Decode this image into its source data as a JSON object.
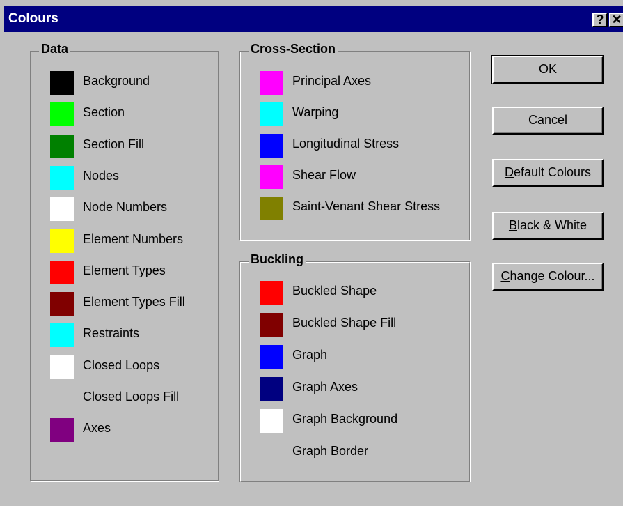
{
  "window": {
    "title": "Colours"
  },
  "titlebar_buttons": {
    "help": "?",
    "close": "✕"
  },
  "data_group": {
    "legend": "Data",
    "items": [
      {
        "label": "Background",
        "color": "#000000"
      },
      {
        "label": "Section",
        "color": "#00ff00"
      },
      {
        "label": "Section Fill",
        "color": "#008000"
      },
      {
        "label": "Nodes",
        "color": "#00ffff"
      },
      {
        "label": "Node Numbers",
        "color": "#ffffff"
      },
      {
        "label": "Element Numbers",
        "color": "#ffff00"
      },
      {
        "label": "Element Types",
        "color": "#ff0000"
      },
      {
        "label": "Element Types Fill",
        "color": "#800000"
      },
      {
        "label": "Restraints",
        "color": "#00ffff"
      },
      {
        "label": "Closed Loops",
        "color": "#ffffff"
      },
      {
        "label": "Closed Loops Fill",
        "color": ""
      },
      {
        "label": "Axes",
        "color": "#800080"
      }
    ]
  },
  "cross_section_group": {
    "legend": "Cross-Section",
    "items": [
      {
        "label": "Principal Axes",
        "color": "#ff00ff"
      },
      {
        "label": "Warping",
        "color": "#00ffff"
      },
      {
        "label": "Longitudinal Stress",
        "color": "#0000ff"
      },
      {
        "label": "Shear Flow",
        "color": "#ff00ff"
      },
      {
        "label": "Saint-Venant Shear Stress",
        "color": "#808000"
      }
    ]
  },
  "buckling_group": {
    "legend": "Buckling",
    "items": [
      {
        "label": "Buckled Shape",
        "color": "#ff0000"
      },
      {
        "label": "Buckled Shape Fill",
        "color": "#800000"
      },
      {
        "label": "Graph",
        "color": "#0000ff"
      },
      {
        "label": "Graph Axes",
        "color": "#000080"
      },
      {
        "label": "Graph Background",
        "color": "#ffffff"
      },
      {
        "label": "Graph Border",
        "color": ""
      }
    ]
  },
  "buttons": {
    "ok": "OK",
    "cancel": "Cancel",
    "default_colours": {
      "mnemonic": "D",
      "rest": "efault Colours"
    },
    "black_white": {
      "mnemonic": "B",
      "rest": "lack & White"
    },
    "change_colour": {
      "mnemonic": "C",
      "rest": "hange Colour..."
    }
  }
}
